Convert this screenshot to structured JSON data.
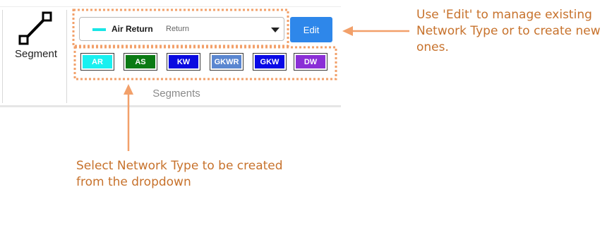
{
  "ribbon": {
    "segment_tool": {
      "label": "Segment",
      "icon": "segment-line-icon"
    },
    "network_type_dropdown": {
      "selected_label": "Air Return",
      "selected_sublabel": "Return",
      "swatch_color": "#19e6e6",
      "icon": "chevron-down-icon"
    },
    "edit_button": {
      "label": "Edit",
      "color": "#2e87ea"
    },
    "quick_types": [
      {
        "code": "AR",
        "color": "#19f0f0"
      },
      {
        "code": "AS",
        "color": "#0a7a14"
      },
      {
        "code": "KW",
        "color": "#0a0ae0"
      },
      {
        "code": "GKWR",
        "color": "#5a86d0"
      },
      {
        "code": "GKW",
        "color": "#0a0ae6"
      },
      {
        "code": "DW",
        "color": "#8a2fd6"
      }
    ],
    "group_label": "Segments"
  },
  "annotations": {
    "edit_callout": "Use 'Edit' to manage existing Network Type or to create new ones.",
    "dropdown_callout": "Select Network Type to be created from the dropdown",
    "accent_color": "#f2a06a"
  }
}
